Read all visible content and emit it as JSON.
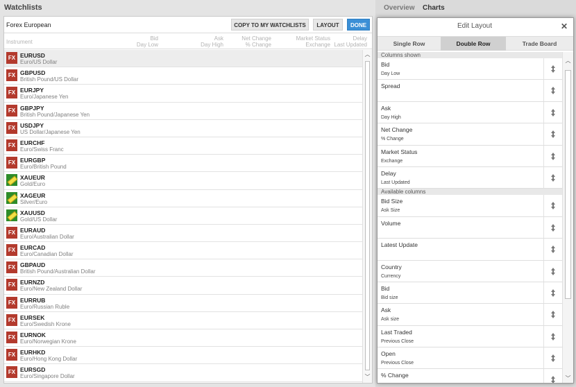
{
  "watchlists": {
    "title": "Watchlists",
    "list_name": "Forex European",
    "toolbar": {
      "copy_label": "COPY TO MY WATCHLISTS",
      "layout_label": "LAYOUT",
      "done_label": "DONE"
    },
    "columns": {
      "instrument": "Instrument",
      "bid": "Bid",
      "bid_sub": "Day Low",
      "ask": "Ask",
      "ask_sub": "Day High",
      "net": "Net Change",
      "net_sub": "% Change",
      "market": "Market Status",
      "market_sub": "Exchange",
      "delay": "Delay",
      "delay_sub": "Last Updated"
    },
    "rows": [
      {
        "badge": "FX",
        "type": "fx",
        "symbol": "EURUSD",
        "desc": "Euro/US Dollar",
        "selected": true
      },
      {
        "badge": "FX",
        "type": "fx",
        "symbol": "GBPUSD",
        "desc": "British Pound/US Dollar"
      },
      {
        "badge": "FX",
        "type": "fx",
        "symbol": "EURJPY",
        "desc": "Euro/Japanese Yen"
      },
      {
        "badge": "FX",
        "type": "fx",
        "symbol": "GBPJPY",
        "desc": "British Pound/Japanese Yen"
      },
      {
        "badge": "FX",
        "type": "fx",
        "symbol": "USDJPY",
        "desc": "US Dollar/Japanese Yen"
      },
      {
        "badge": "FX",
        "type": "fx",
        "symbol": "EURCHF",
        "desc": "Euro/Swiss Franc"
      },
      {
        "badge": "FX",
        "type": "fx",
        "symbol": "EURGBP",
        "desc": "Euro/British Pound"
      },
      {
        "badge": "",
        "type": "metal",
        "symbol": "XAUEUR",
        "desc": "Gold/Euro"
      },
      {
        "badge": "",
        "type": "metal",
        "symbol": "XAGEUR",
        "desc": "Silver/Euro"
      },
      {
        "badge": "",
        "type": "metal",
        "symbol": "XAUUSD",
        "desc": "Gold/US Dollar"
      },
      {
        "badge": "FX",
        "type": "fx",
        "symbol": "EURAUD",
        "desc": "Euro/Australian Dollar"
      },
      {
        "badge": "FX",
        "type": "fx",
        "symbol": "EURCAD",
        "desc": "Euro/Canadian Dollar"
      },
      {
        "badge": "FX",
        "type": "fx",
        "symbol": "GBPAUD",
        "desc": "British Pound/Australian Dollar"
      },
      {
        "badge": "FX",
        "type": "fx",
        "symbol": "EURNZD",
        "desc": "Euro/New Zealand Dollar"
      },
      {
        "badge": "FX",
        "type": "fx",
        "symbol": "EURRUB",
        "desc": "Euro/Russian Ruble"
      },
      {
        "badge": "FX",
        "type": "fx",
        "symbol": "EURSEK",
        "desc": "Euro/Swedish Krone"
      },
      {
        "badge": "FX",
        "type": "fx",
        "symbol": "EURNOK",
        "desc": "Euro/Norwegian Krone"
      },
      {
        "badge": "FX",
        "type": "fx",
        "symbol": "EURHKD",
        "desc": "Euro/Hong Kong Dollar"
      },
      {
        "badge": "FX",
        "type": "fx",
        "symbol": "EURSGD",
        "desc": "Euro/Singapore Dollar"
      }
    ]
  },
  "right_tabs": {
    "overview": "Overview",
    "charts": "Charts"
  },
  "dialog": {
    "title": "Edit Layout",
    "close": "✕",
    "tabs": {
      "single": "Single Row",
      "double": "Double Row",
      "trade": "Trade Board"
    },
    "active_tab": "Double Row",
    "shown_header": "Columns shown",
    "available_header": "Available columns",
    "shown": [
      {
        "line1": "Bid",
        "line2": "Day Low"
      },
      {
        "line1": "Spread",
        "line2": ""
      },
      {
        "line1": "Ask",
        "line2": "Day High"
      },
      {
        "line1": "Net Change",
        "line2": "% Change"
      },
      {
        "line1": "Market Status",
        "line2": "Exchange"
      },
      {
        "line1": "Delay",
        "line2": "Last Updated"
      }
    ],
    "available": [
      {
        "line1": "Bid Size",
        "line2": "Ask Size"
      },
      {
        "line1": "Volume",
        "line2": ""
      },
      {
        "line1": "Latest Update",
        "line2": ""
      },
      {
        "line1": "Country",
        "line2": "Currency"
      },
      {
        "line1": "Bid",
        "line2": "Bid size"
      },
      {
        "line1": "Ask",
        "line2": "Ask size"
      },
      {
        "line1": "Last Traded",
        "line2": "Previous Close"
      },
      {
        "line1": "Open",
        "line2": "Previous Close"
      },
      {
        "line1": "% Change",
        "line2": ""
      }
    ]
  },
  "colors": {
    "accent": "#3b8fd6",
    "fx_badge": "#b33a2d",
    "metal_badge": "#2e8c2a"
  }
}
